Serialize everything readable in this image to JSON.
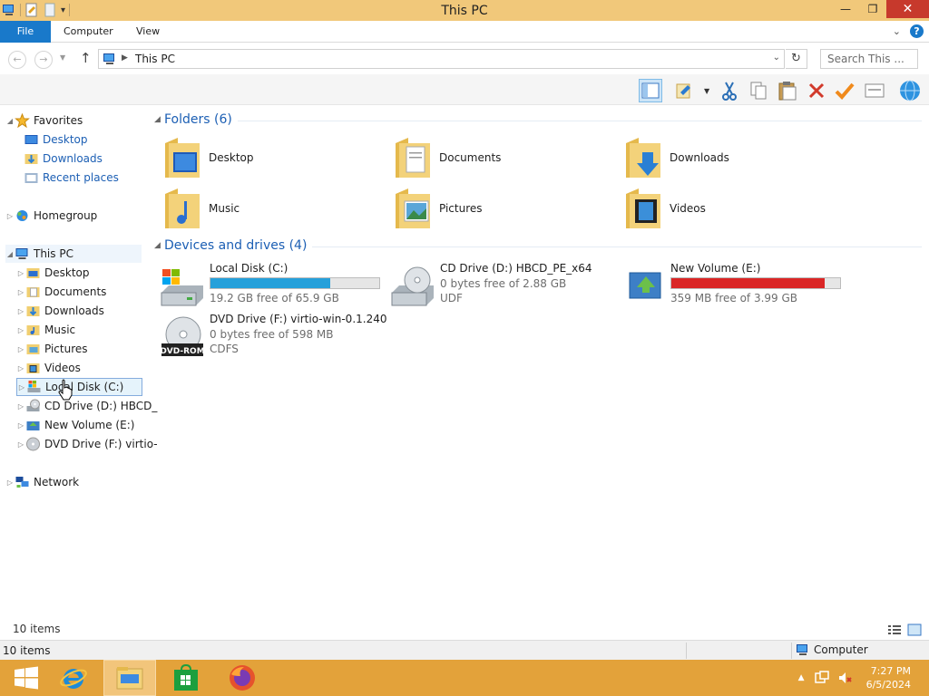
{
  "window": {
    "title": "This PC"
  },
  "ribbon": {
    "tabs": [
      "File",
      "Computer",
      "View"
    ]
  },
  "address": {
    "breadcrumb": "This PC",
    "search_placeholder": "Search This ..."
  },
  "nav_pane": {
    "favorites": {
      "label": "Favorites",
      "items": [
        "Desktop",
        "Downloads",
        "Recent places"
      ]
    },
    "homegroup": "Homegroup",
    "this_pc": {
      "label": "This PC",
      "items": [
        "Desktop",
        "Documents",
        "Downloads",
        "Music",
        "Pictures",
        "Videos",
        "Local Disk (C:)",
        "CD Drive (D:) HBCD_",
        "New Volume (E:)",
        "DVD Drive (F:) virtio-"
      ]
    },
    "network": "Network"
  },
  "content": {
    "folders_header": "Folders (6)",
    "folders": [
      "Desktop",
      "Documents",
      "Downloads",
      "Music",
      "Pictures",
      "Videos"
    ],
    "drives_header": "Devices and drives (4)",
    "drives": [
      {
        "name": "Local Disk (C:)",
        "free": "19.2 GB free of 65.9 GB",
        "used_fraction": 0.71,
        "bar_color": "#26a0da"
      },
      {
        "name": "CD Drive (D:) HBCD_PE_x64",
        "free": "0 bytes free of 2.88 GB",
        "fs": "UDF"
      },
      {
        "name": "New Volume (E:)",
        "free": "359 MB free of 3.99 GB",
        "used_fraction": 0.91,
        "bar_color": "#da2626"
      },
      {
        "name": "DVD Drive (F:) virtio-win-0.1.240",
        "free": "0 bytes free of 598 MB",
        "fs": "CDFS"
      }
    ]
  },
  "status": {
    "items_count": "10 items",
    "items_count_bottom": "10 items",
    "location": "Computer"
  },
  "taskbar": {
    "time": "7:27 PM",
    "date": "6/5/2024"
  },
  "colors": {
    "titlebar": "#f1c87a",
    "accent": "#1979ca",
    "taskbar": "#e3a23a",
    "link": "#1c5fb4"
  }
}
